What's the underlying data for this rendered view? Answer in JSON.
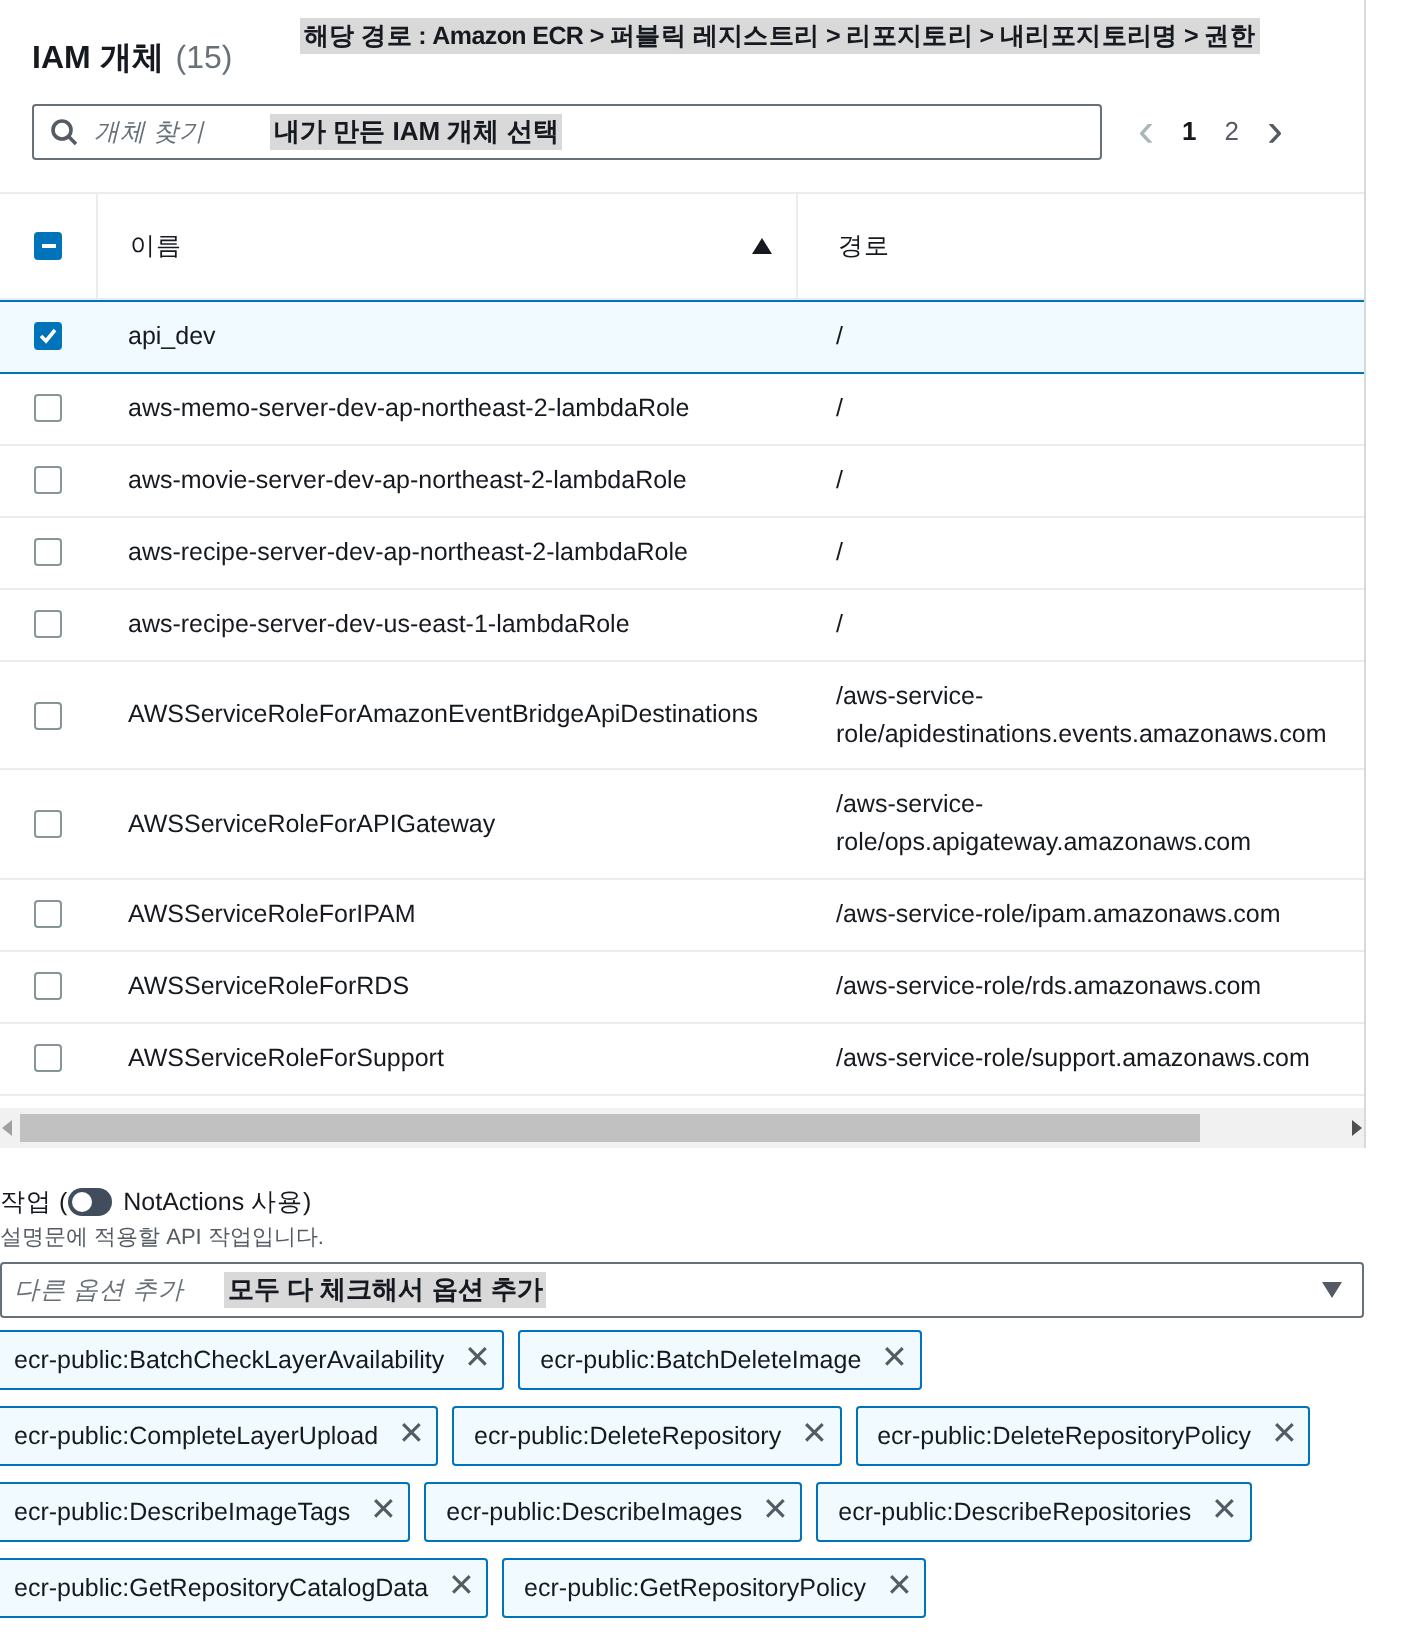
{
  "panel": {
    "title": "IAM 개체",
    "count": "(15)",
    "annotation": "해당 경로 : Amazon ECR > 퍼블릭 레지스트리 > 리포지토리 > 내리포지토리명 > 권한"
  },
  "search": {
    "placeholder": "개체 찾기",
    "annotation": "내가 만든 IAM 개체 선택"
  },
  "pagination": {
    "prev": "‹",
    "pages": [
      {
        "label": "1",
        "selected": true
      },
      {
        "label": "2",
        "selected": false
      }
    ],
    "next": "›"
  },
  "table": {
    "select_all": {
      "indeterminate": true
    },
    "columns": [
      {
        "label": "이름",
        "sort_ascending": true
      },
      {
        "label": "경로"
      }
    ],
    "rows": [
      {
        "name": "api_dev",
        "path": "/",
        "selected": true
      },
      {
        "name": "aws-memo-server-dev-ap-northeast-2-lambdaRole",
        "path": "/",
        "selected": false
      },
      {
        "name": "aws-movie-server-dev-ap-northeast-2-lambdaRole",
        "path": "/",
        "selected": false
      },
      {
        "name": "aws-recipe-server-dev-ap-northeast-2-lambdaRole",
        "path": "/",
        "selected": false
      },
      {
        "name": "aws-recipe-server-dev-us-east-1-lambdaRole",
        "path": "/",
        "selected": false
      },
      {
        "name": "AWSServiceRoleForAmazonEventBridgeApiDestinations",
        "path": "/aws-service-role/apidestinations.events.amazonaws.com",
        "selected": false
      },
      {
        "name": "AWSServiceRoleForAPIGateway",
        "path": "/aws-service-role/ops.apigateway.amazonaws.com",
        "selected": false
      },
      {
        "name": "AWSServiceRoleForIPAM",
        "path": "/aws-service-role/ipam.amazonaws.com",
        "selected": false
      },
      {
        "name": "AWSServiceRoleForRDS",
        "path": "/aws-service-role/rds.amazonaws.com",
        "selected": false
      },
      {
        "name": "AWSServiceRoleForSupport",
        "path": "/aws-service-role/support.amazonaws.com",
        "selected": false
      }
    ]
  },
  "actions": {
    "label_start": "작업 (",
    "toggle": {
      "on": false,
      "label": "NotActions 사용)"
    },
    "description": "설명문에 적용할 API 작업입니다.",
    "select": {
      "placeholder": "다른 옵션 추가",
      "annotation": "모두 다 체크해서 옵션 추가"
    },
    "tokens": [
      [
        {
          "label": "ecr-public:BatchCheckLayerAvailability"
        },
        {
          "label": "ecr-public:BatchDeleteImage"
        }
      ],
      [
        {
          "label": "ecr-public:CompleteLayerUpload"
        },
        {
          "label": "ecr-public:DeleteRepository"
        },
        {
          "label": "ecr-public:DeleteRepositoryPolicy"
        }
      ],
      [
        {
          "label": "ecr-public:DescribeImageTags"
        },
        {
          "label": "ecr-public:DescribeImages"
        },
        {
          "label": "ecr-public:DescribeRepositories"
        }
      ],
      [
        {
          "label": "ecr-public:GetRepositoryCatalogData"
        },
        {
          "label": "ecr-public:GetRepositoryPolicy"
        }
      ]
    ],
    "remove": "✕"
  }
}
